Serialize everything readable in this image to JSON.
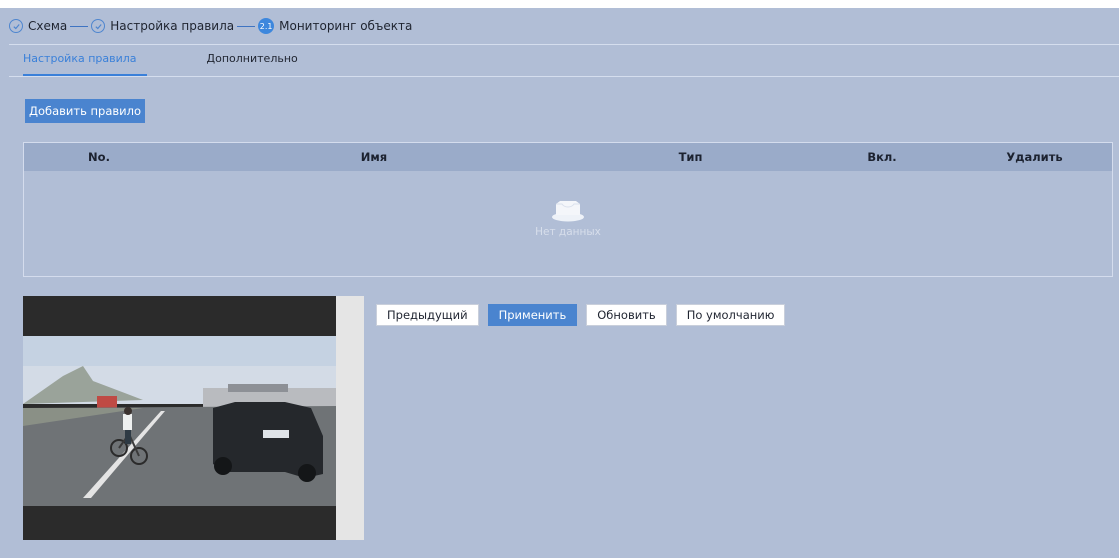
{
  "steps": [
    {
      "label": "Схема",
      "state": "done",
      "icon": "check-icon"
    },
    {
      "label": "Настройка правила",
      "state": "done",
      "icon": "check-icon"
    },
    {
      "label": "Мониторинг объекта",
      "state": "current",
      "number": "2.1"
    }
  ],
  "tabs": [
    {
      "label": "Настройка правила",
      "active": true
    },
    {
      "label": "Дополнительно",
      "active": false
    }
  ],
  "add_rule_label": "Добавить правило",
  "table": {
    "columns": [
      "No.",
      "Имя",
      "Тип",
      "Вкл.",
      "Удалить"
    ],
    "rows": [],
    "empty_text": "Нет данных",
    "empty_icon": "empty-box-icon"
  },
  "actions": {
    "prev": "Предыдущий",
    "apply": "Применить",
    "refresh": "Обновить",
    "default": "По умолчанию"
  },
  "colors": {
    "background": "#b1bed6",
    "accent": "#4a84cf",
    "header_row": "#9aabc9"
  }
}
